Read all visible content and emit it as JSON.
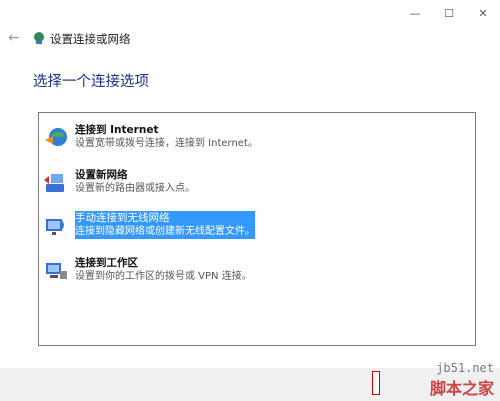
{
  "window": {
    "controls": {
      "minimize": "—",
      "maximize": "☐",
      "close": "✕"
    }
  },
  "nav": {
    "back_icon": "back-arrow-icon",
    "title": "设置连接或网络"
  },
  "heading": "选择一个连接选项",
  "options": [
    {
      "title": "连接到 Internet",
      "desc": "设置宽带或拨号连接，连接到 Internet。",
      "icon": "globe-connect-icon",
      "selected": false
    },
    {
      "title": "设置新网络",
      "desc": "设置新的路由器或接入点。",
      "icon": "router-setup-icon",
      "selected": false
    },
    {
      "title": "手动连接到无线网络",
      "desc": "连接到隐藏网络或创建新无线配置文件。",
      "icon": "wireless-network-icon",
      "selected": true
    },
    {
      "title": "连接到工作区",
      "desc": "设置到你的工作区的拨号或 VPN 连接。",
      "icon": "workplace-vpn-icon",
      "selected": false
    }
  ],
  "footer": {
    "next_label": "",
    "watermark_url": "jb51.net",
    "watermark_text": "脚本之家"
  },
  "colors": {
    "heading": "#1e3287",
    "selection": "#3399ff",
    "listbox_border": "#7a7a7a"
  }
}
